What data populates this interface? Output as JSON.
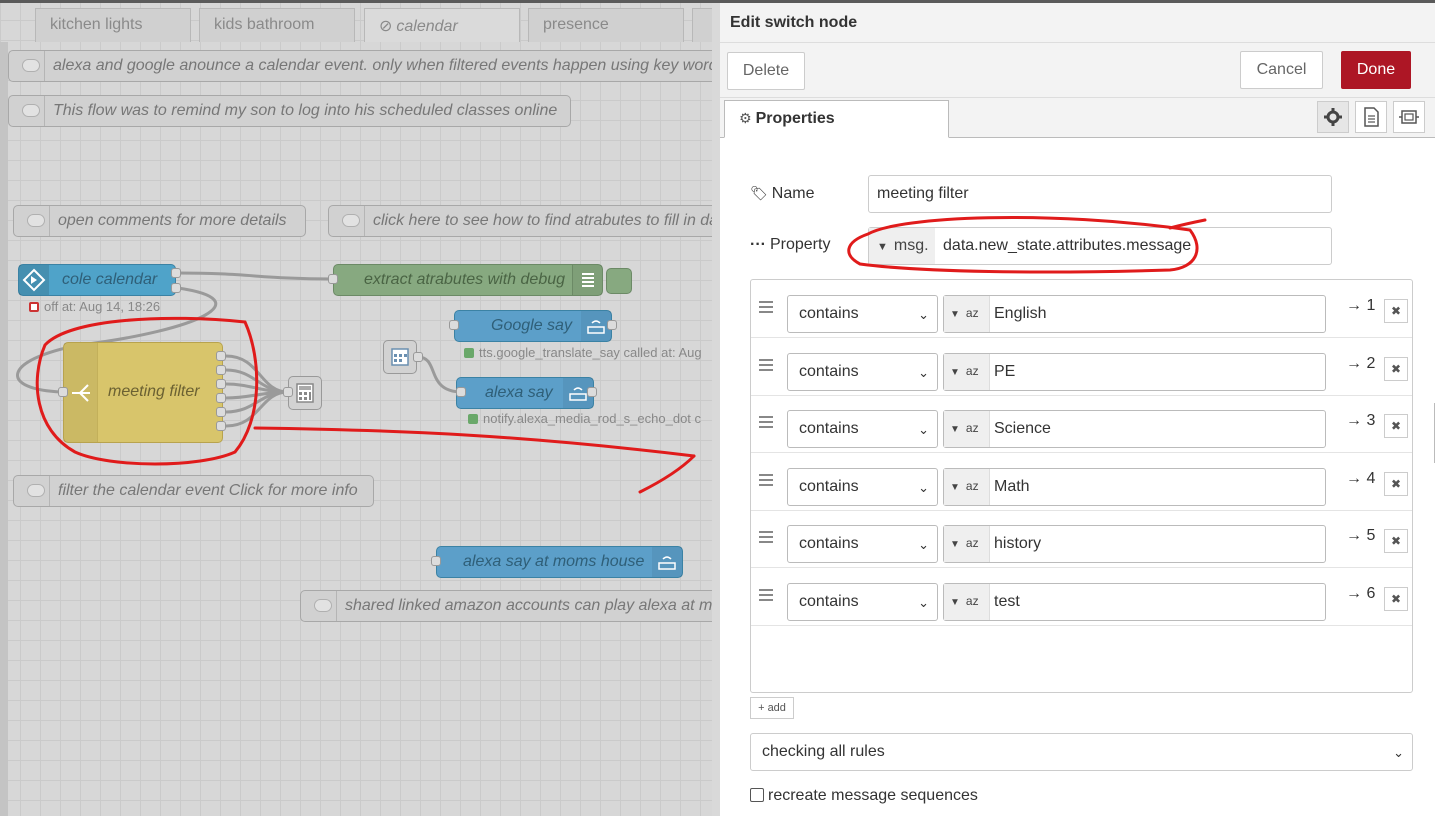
{
  "workspace": {
    "tabs": [
      {
        "label": "kitchen lights"
      },
      {
        "label": "kids bathroom"
      },
      {
        "label": "calendar",
        "disabled": true
      },
      {
        "label": "presence"
      }
    ],
    "comments": [
      {
        "text": "alexa and google anounce a calendar event. only when filtered events happen using key words"
      },
      {
        "text": "This flow was to remind my son to log into his scheduled classes online"
      },
      {
        "text": "open comments for more details"
      },
      {
        "text": "click here to see how to find atrabutes to fill in da"
      },
      {
        "text": "filter the calendar event Click for more info"
      },
      {
        "text": "shared linked amazon accounts can play alexa at mo"
      }
    ],
    "nodes": {
      "cole_calendar": {
        "label": "cole calendar",
        "status": "off at: Aug 14, 18:26",
        "color": "#4fa3c9"
      },
      "extract": {
        "label": "extract atrabutes with debug",
        "color": "#87a980"
      },
      "google_say": {
        "label": "Google say",
        "status": "tts.google_translate_say called at: Aug",
        "color": "#5c9fc9"
      },
      "alexa_say": {
        "label": "alexa say",
        "status": "notify.alexa_media_rod_s_echo_dot c",
        "color": "#5c9fc9"
      },
      "meeting_filter": {
        "label": "meeting filter",
        "color": "#d8c56b"
      },
      "alexa_moms": {
        "label": "alexa say at moms house",
        "color": "#5c9fc9"
      }
    }
  },
  "tray": {
    "title": "Edit switch node",
    "delete_label": "Delete",
    "cancel_label": "Cancel",
    "done_label": "Done",
    "properties_tab": "Properties",
    "name_label": "Name",
    "name_value": "meeting filter",
    "property_label": "Property",
    "property_prefix": "msg.",
    "property_value": "data.new_state.attributes.message",
    "rules": [
      {
        "op": "contains",
        "value": "English",
        "output": "→ 1"
      },
      {
        "op": "contains",
        "value": "PE",
        "output": "→ 2"
      },
      {
        "op": "contains",
        "value": "Science",
        "output": "→ 3"
      },
      {
        "op": "contains",
        "value": "Math",
        "output": "→ 4"
      },
      {
        "op": "contains",
        "value": "history",
        "output": "→ 5"
      },
      {
        "op": "contains",
        "value": "test",
        "output": "→ 6"
      }
    ],
    "type_glyph": "az",
    "add_label": "add",
    "checking_value": "checking all rules",
    "recreate_label": "recreate message sequences"
  },
  "colors": {
    "done": "#ad1625",
    "annotation": "#e01b1b"
  }
}
